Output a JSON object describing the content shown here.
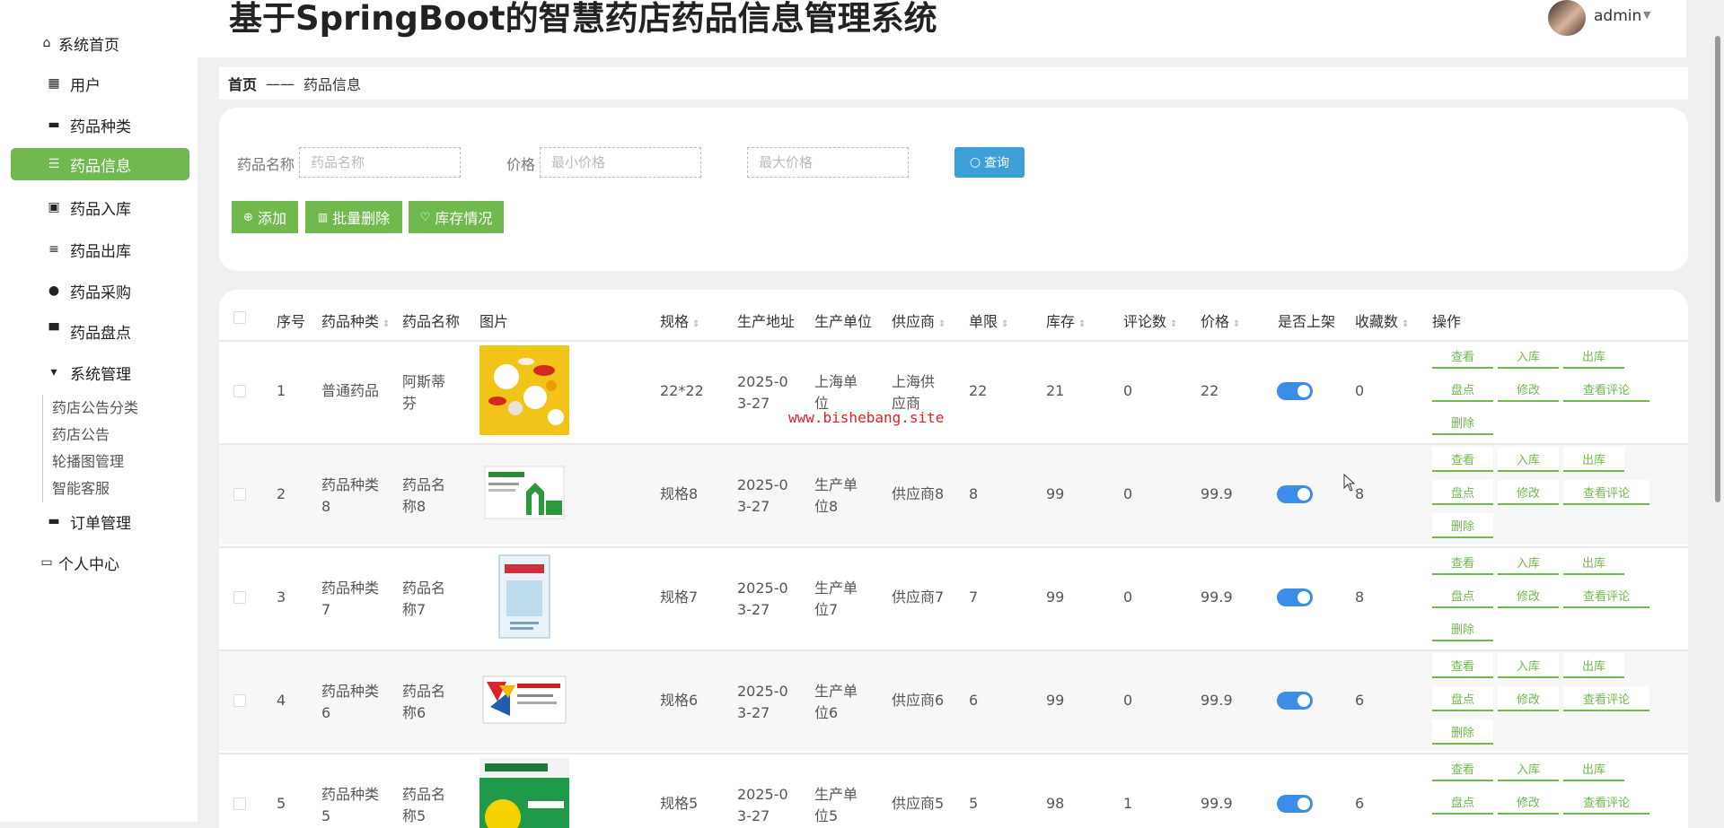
{
  "app_title": "基于SpringBoot的智慧药店药品信息管理系统",
  "user": {
    "name": "admin"
  },
  "sidebar": {
    "items": [
      {
        "label": "系统首页",
        "icon": "home-icon"
      },
      {
        "label": "用户",
        "icon": "grid-icon"
      },
      {
        "label": "药品种类",
        "icon": "tag-icon"
      },
      {
        "label": "药品信息",
        "icon": "sliders-icon",
        "active": true
      },
      {
        "label": "药品入库",
        "icon": "clipboard-icon"
      },
      {
        "label": "药品出库",
        "icon": "list-icon"
      },
      {
        "label": "药品采购",
        "icon": "bulb-icon"
      },
      {
        "label": "药品盘点",
        "icon": "monitor-icon"
      },
      {
        "label": "系统管理",
        "icon": "settings-icon"
      },
      {
        "label": "订单管理",
        "icon": "briefcase-icon"
      },
      {
        "label": "个人中心",
        "icon": "card-icon"
      }
    ],
    "sub_items": [
      "药店公告分类",
      "药店公告",
      "轮播图管理",
      "智能客服"
    ]
  },
  "breadcrumb": {
    "home": "首页",
    "separator": "——",
    "current": "药品信息"
  },
  "search": {
    "name_label": "药品名称",
    "name_placeholder": "药品名称",
    "price_label": "价格",
    "min_price_placeholder": "最小价格",
    "max_price_placeholder": "最大价格",
    "query_button": "查询"
  },
  "actions": {
    "add": "添加",
    "batch_delete": "批量删除",
    "stock_status": "库存情况"
  },
  "table": {
    "columns": [
      "序号",
      "药品种类",
      "药品名称",
      "图片",
      "规格",
      "生产地址",
      "生产单位",
      "供应商",
      "单限",
      "库存",
      "评论数",
      "价格",
      "是否上架",
      "收藏数",
      "操作"
    ],
    "rows": [
      {
        "index": "1",
        "category": "普通药品",
        "name": "阿斯蒂芬",
        "spec": "22*22",
        "address": "2025-03-27",
        "unit": "上海单位",
        "supplier": "上海供应商",
        "limit": "22",
        "stock": "21",
        "comments": "0",
        "price": "22",
        "on_shelf": true,
        "favorites": "0"
      },
      {
        "index": "2",
        "category": "药品种类8",
        "name": "药品名称8",
        "spec": "规格8",
        "address": "2025-03-27",
        "unit": "生产单位8",
        "supplier": "供应商8",
        "limit": "8",
        "stock": "99",
        "comments": "0",
        "price": "99.9",
        "on_shelf": true,
        "favorites": "8"
      },
      {
        "index": "3",
        "category": "药品种类7",
        "name": "药品名称7",
        "spec": "规格7",
        "address": "2025-03-27",
        "unit": "生产单位7",
        "supplier": "供应商7",
        "limit": "7",
        "stock": "99",
        "comments": "0",
        "price": "99.9",
        "on_shelf": true,
        "favorites": "8"
      },
      {
        "index": "4",
        "category": "药品种类6",
        "name": "药品名称6",
        "spec": "规格6",
        "address": "2025-03-27",
        "unit": "生产单位6",
        "supplier": "供应商6",
        "limit": "6",
        "stock": "99",
        "comments": "0",
        "price": "99.9",
        "on_shelf": true,
        "favorites": "6"
      },
      {
        "index": "5",
        "category": "药品种类5",
        "name": "药品名称5",
        "spec": "规格5",
        "address": "2025-03-27",
        "unit": "生产单位5",
        "supplier": "供应商5",
        "limit": "5",
        "stock": "98",
        "comments": "1",
        "price": "99.9",
        "on_shelf": true,
        "favorites": "6"
      }
    ],
    "row_actions": [
      "查看",
      "入库",
      "出库",
      "盘点",
      "修改",
      "查看评论",
      "删除"
    ]
  },
  "watermark": "www.bishebang.site"
}
